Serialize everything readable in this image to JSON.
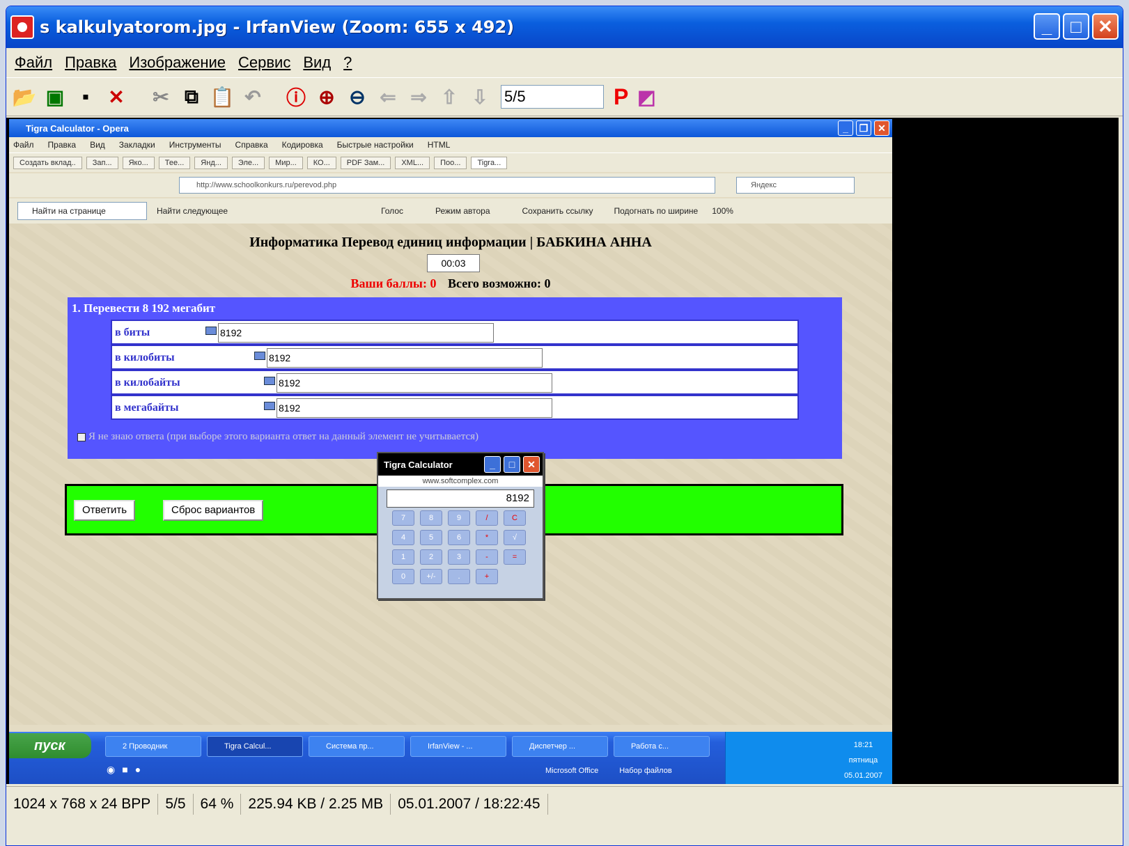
{
  "window": {
    "title": "s kalkulyatorom.jpg - IrfanView (Zoom: 655 x 492)"
  },
  "menu": [
    "Файл",
    "Правка",
    "Изображение",
    "Сервис",
    "Вид",
    "?"
  ],
  "toolbar": {
    "page": "5/5",
    "p_label": "P"
  },
  "opera": {
    "title": "Tigra Calculator - Opera",
    "menu": [
      "Файл",
      "Правка",
      "Вид",
      "Закладки",
      "Инструменты",
      "Справка",
      "Кодировка",
      "Быстрые настройки",
      "HTML"
    ],
    "tabs": [
      "Создать вклад..",
      "Зап...",
      "Яко...",
      "Тее...",
      "Янд...",
      "Эле...",
      "Мир...",
      "КО...",
      "PDF Зам...",
      "XML...",
      "Поо...",
      "Tigra..."
    ],
    "address": "http://www.schoolkonkurs.ru/perevod.php",
    "search": "Яндекс",
    "find_placeholder": "Найти на странице",
    "links": [
      "Найти следующее",
      "Голос",
      "Режим автора",
      "Сохранить ссылку",
      "Подогнать по ширине",
      "100%"
    ]
  },
  "page": {
    "heading": "Информатика Перевод единиц информации | БАБКИНА АННА",
    "timer": "00:03",
    "score_label": "Ваши баллы: 0",
    "score_total": "Всего возможно: 0",
    "question": "1. Перевести 8 192 мегабит",
    "rows": [
      {
        "label": "в биты",
        "value": "8192"
      },
      {
        "label": "в килобиты",
        "value": "8192"
      },
      {
        "label": "в килобайты",
        "value": "8192"
      },
      {
        "label": "в мегабайты",
        "value": "8192"
      }
    ],
    "checkbox_note": "Я не знаю ответа (при выборе этого варианта ответ на данный элемент не учитывается)",
    "answer_btn": "Ответить",
    "reset_btn": "Сброс вариантов"
  },
  "calculator": {
    "title": "Tigra Calculator",
    "url": "www.softcomplex.com",
    "display": "8192",
    "keys": [
      "7",
      "8",
      "9",
      "/",
      "C",
      "4",
      "5",
      "6",
      "*",
      "√",
      "1",
      "2",
      "3",
      "-",
      "=",
      "0",
      "+/-",
      ".",
      "+"
    ]
  },
  "taskbar": {
    "start": "пуск",
    "tasks": [
      "2 Проводник",
      "Tigra Calcul...",
      "Система пр...",
      "IrfanView - ...",
      "Диспетчер ...",
      "Работа с..."
    ],
    "quick": [
      "Microsoft Office",
      "Набор файлов"
    ],
    "time": "18:21",
    "day": "пятница",
    "date": "05.01.2007"
  },
  "status": [
    "1024 x 768 x 24 BPP",
    "5/5",
    "64 %",
    "225.94 KB / 2.25 MB",
    "05.01.2007 / 18:22:45"
  ]
}
